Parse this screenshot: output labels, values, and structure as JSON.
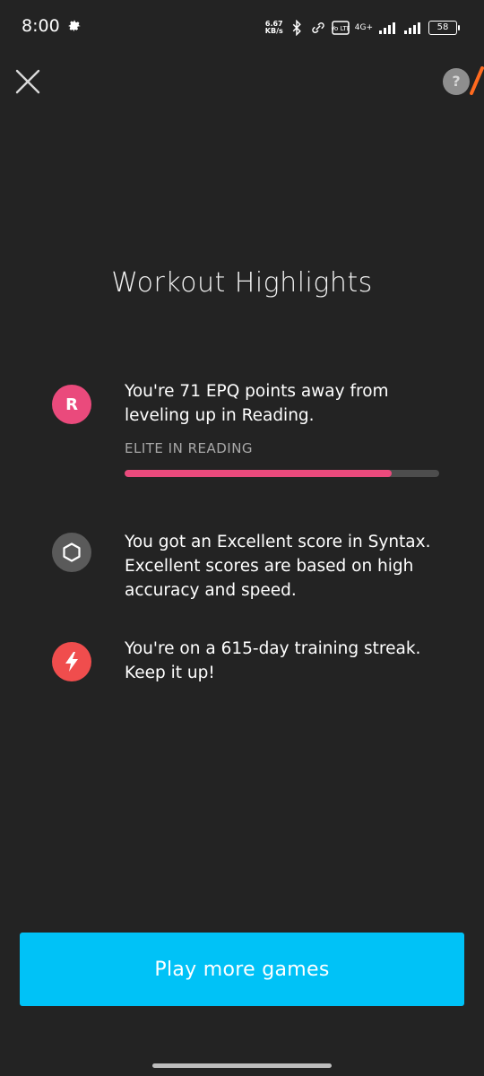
{
  "status_bar": {
    "time": "8:00",
    "net_speed_value": "6.67",
    "net_speed_unit": "KB/s",
    "volte_label": "Vo LTE",
    "network_label": "4G+",
    "battery_level": "58"
  },
  "header": {
    "help_label": "?"
  },
  "page": {
    "title": "Workout Highlights"
  },
  "highlights": [
    {
      "badge_text": "R",
      "text": "You're 71 EPQ points away from leveling up in Reading.",
      "level_label": "ELITE IN READING",
      "progress_fraction": 0.85,
      "color": "#ea4a7c"
    },
    {
      "badge_icon": "hexagon-icon",
      "text": "You got an Excellent score in Syntax. Excellent scores are based on high accuracy and speed."
    },
    {
      "badge_icon": "lightning-bolt-icon",
      "text": "You're on a 615-day training streak. Keep it up!",
      "color": "#f04d4d"
    }
  ],
  "cta": {
    "label": "Play more games",
    "color": "#00c2f7"
  }
}
